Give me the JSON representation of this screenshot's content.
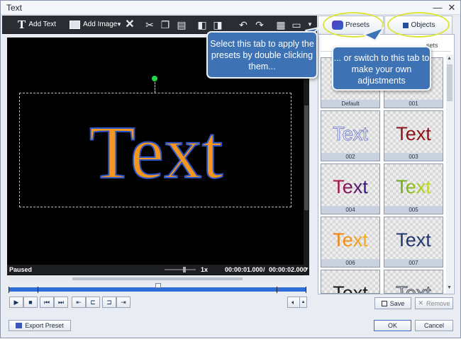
{
  "window": {
    "title": "Text"
  },
  "toolbar": {
    "add_text": "Add Text",
    "add_image": "Add Image"
  },
  "preview": {
    "text": "Text",
    "status": "Paused",
    "speed": "1x",
    "time_current": "00:00:01.000",
    "time_total": "00:00:02.000",
    "text_color": "#f7961c",
    "text_outline": "#2b56c8"
  },
  "tabs": {
    "presets": "Presets",
    "objects": "Objects"
  },
  "presets_header": "sets",
  "presets": [
    {
      "label": "Default",
      "text": "",
      "style": "none"
    },
    {
      "label": "001",
      "text": "",
      "style": "none"
    },
    {
      "label": "002",
      "text": "Text",
      "style": "outline-lilac"
    },
    {
      "label": "003",
      "text": "Text",
      "style": "solid-red"
    },
    {
      "label": "004",
      "text": "Text",
      "style": "gradient-purple"
    },
    {
      "label": "005",
      "text": "Text",
      "style": "gradient-lime"
    },
    {
      "label": "006",
      "text": "Text",
      "style": "gradient-orange"
    },
    {
      "label": "007",
      "text": "Text",
      "style": "solid-navy"
    },
    {
      "label": "",
      "text": "Text",
      "style": "solid-dark"
    },
    {
      "label": "",
      "text": "Text",
      "style": "outline-gray"
    }
  ],
  "buttons": {
    "save": "Save",
    "remove": "Remove",
    "export_preset": "Export Preset",
    "ok": "OK",
    "cancel": "Cancel"
  },
  "callouts": {
    "presets_tip": "Select this tab to apply the presets by double clicking them...",
    "objects_tip": "... or switch to this tab to make your own adjustments"
  }
}
